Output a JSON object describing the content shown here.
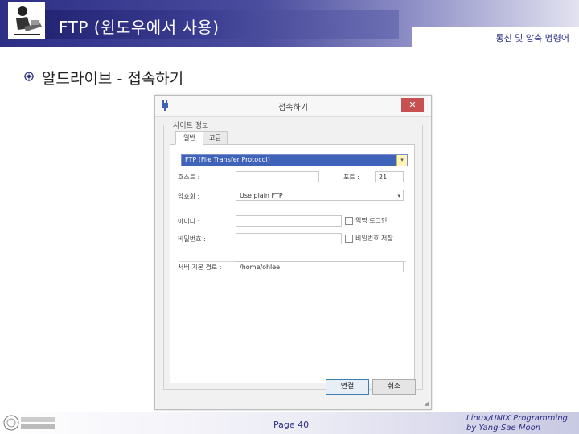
{
  "slide": {
    "title": "FTP (윈도우에서 사용)",
    "section": "통신 및 압축 명령어",
    "bullet": "알드라이브 - 접속하기",
    "page": "Page 40",
    "credit_line1": "Linux/UNIX Programming",
    "credit_line2": "by Yang-Sae Moon",
    "logo_text": "강원대학교 컴퓨터과학과"
  },
  "dialog": {
    "title": "접속하기",
    "close_glyph": "✕",
    "group_label": "사이트 정보",
    "tabs": [
      {
        "label": "일반"
      },
      {
        "label": "고급"
      }
    ],
    "protocol_value": "FTP (File Transfer Protocol)",
    "dropdown_glyph": "▾",
    "host_label": "호스트 :",
    "host_value": "",
    "port_label": "포트 :",
    "port_value": "21",
    "encryption_label": "암호화 :",
    "encryption_value": "Use plain FTP",
    "userid_label": "아이디 :",
    "userid_value": "",
    "anonymous_label": "익명 로그인",
    "password_label": "비밀번호 :",
    "password_value": "",
    "save_password_label": "비밀번호 저장",
    "server_path_label": "서버 기본 경로 :",
    "server_path_value": "/home/ohlee",
    "ok_label": "연결",
    "cancel_label": "취소",
    "colors": {
      "accent": "#3e63b8",
      "close": "#c75050"
    }
  }
}
